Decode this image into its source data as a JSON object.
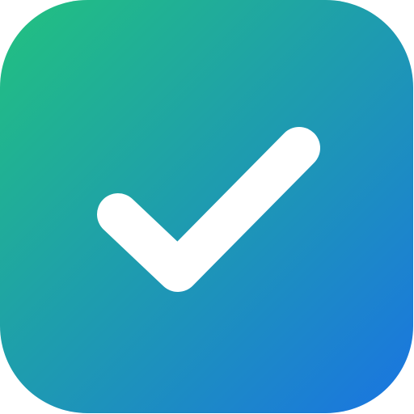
{
  "app_icon": {
    "icon_name": "checkmark-icon",
    "gradient": {
      "start_color": "#22C17F",
      "end_color": "#1A74E2"
    },
    "glyph_color": "#FFFFFF",
    "checked": true
  }
}
